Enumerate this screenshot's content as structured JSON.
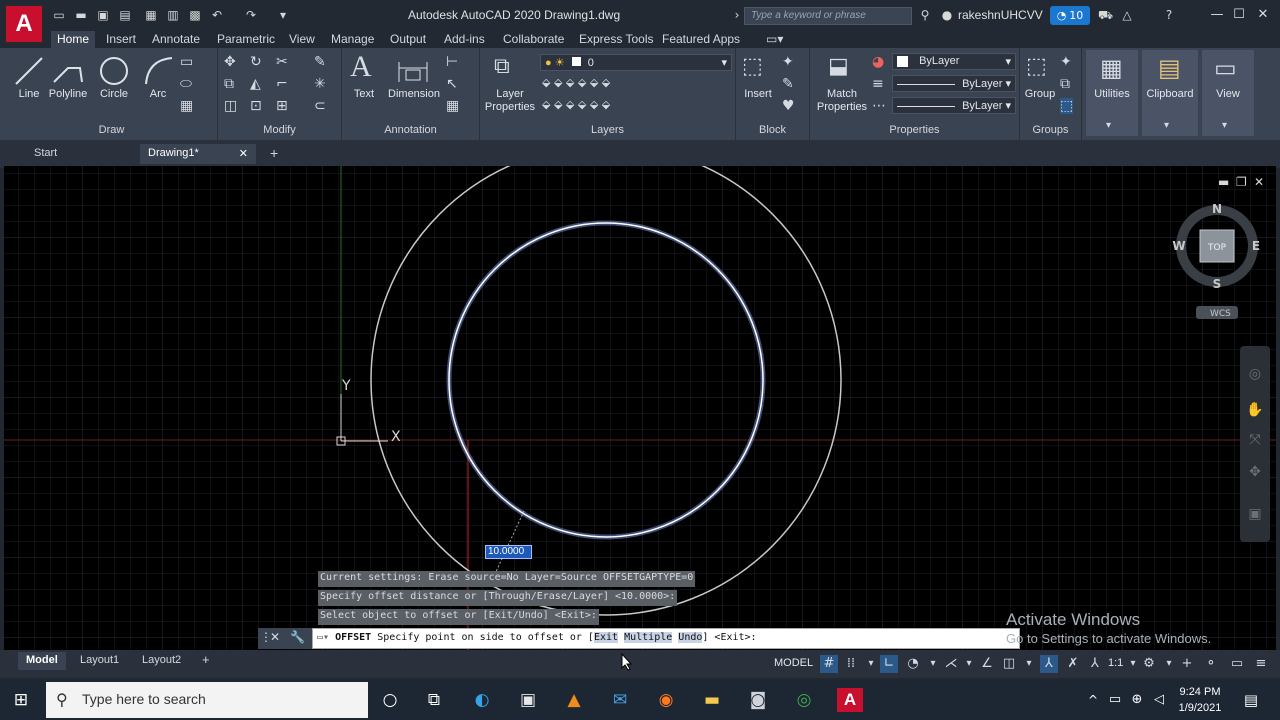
{
  "app": {
    "logo": "A",
    "title": "Autodesk AutoCAD 2020   Drawing1.dwg",
    "search_placeholder": "Type a keyword or phrase",
    "user": "rakeshnUHCVV",
    "badge_count": "10"
  },
  "ribbon_tabs": [
    "Home",
    "Insert",
    "Annotate",
    "Parametric",
    "View",
    "Manage",
    "Output",
    "Add-ins",
    "Collaborate",
    "Express Tools",
    "Featured Apps"
  ],
  "draw": {
    "title": "Draw",
    "tools": [
      "Line",
      "Polyline",
      "Circle",
      "Arc"
    ]
  },
  "modify": {
    "title": "Modify"
  },
  "annotation": {
    "title": "Annotation",
    "tools": [
      "Text",
      "Dimension"
    ]
  },
  "layers": {
    "title": "Layers",
    "layer_props": "Layer Properties",
    "current_layer": "0"
  },
  "block": {
    "title": "Block",
    "insert": "Insert"
  },
  "properties": {
    "title": "Properties",
    "match": "Match Properties",
    "color": "ByLayer",
    "linetype": "ByLayer",
    "lineweight": "ByLayer"
  },
  "groups": {
    "title": "Groups",
    "group": "Group"
  },
  "side_buttons": [
    "Utilities",
    "Clipboard",
    "View"
  ],
  "file_tabs": {
    "start": "Start",
    "drawing": "Drawing1*"
  },
  "viewcube": {
    "n": "N",
    "s": "S",
    "e": "E",
    "w": "W",
    "top": "TOP",
    "wcs": "WCS"
  },
  "ucs": {
    "x": "X",
    "y": "Y"
  },
  "dynamic_input": "10.0000",
  "command_history": [
    "Current settings: Erase source=No  Layer=Source  OFFSETGAPTYPE=0",
    "Specify offset distance or [Through/Erase/Layer] <10.0000>:",
    "Select object to offset or [Exit/Undo] <Exit>:"
  ],
  "command_line": {
    "cmd": "OFFSET",
    "prompt": "Specify point on side to offset or [",
    "opt1": "Exit",
    "opt2": "Multiple",
    "opt3": "Undo",
    "tail": "] <Exit>:"
  },
  "layout_tabs": [
    "Model",
    "Layout1",
    "Layout2"
  ],
  "status": {
    "model": "MODEL",
    "scale": "1:1"
  },
  "watermark": {
    "line1": "Activate Windows",
    "line2": "Go to Settings to activate Windows."
  },
  "taskbar": {
    "search_placeholder": "Type here to search",
    "time": "9:24 PM",
    "date": "1/9/2021"
  }
}
